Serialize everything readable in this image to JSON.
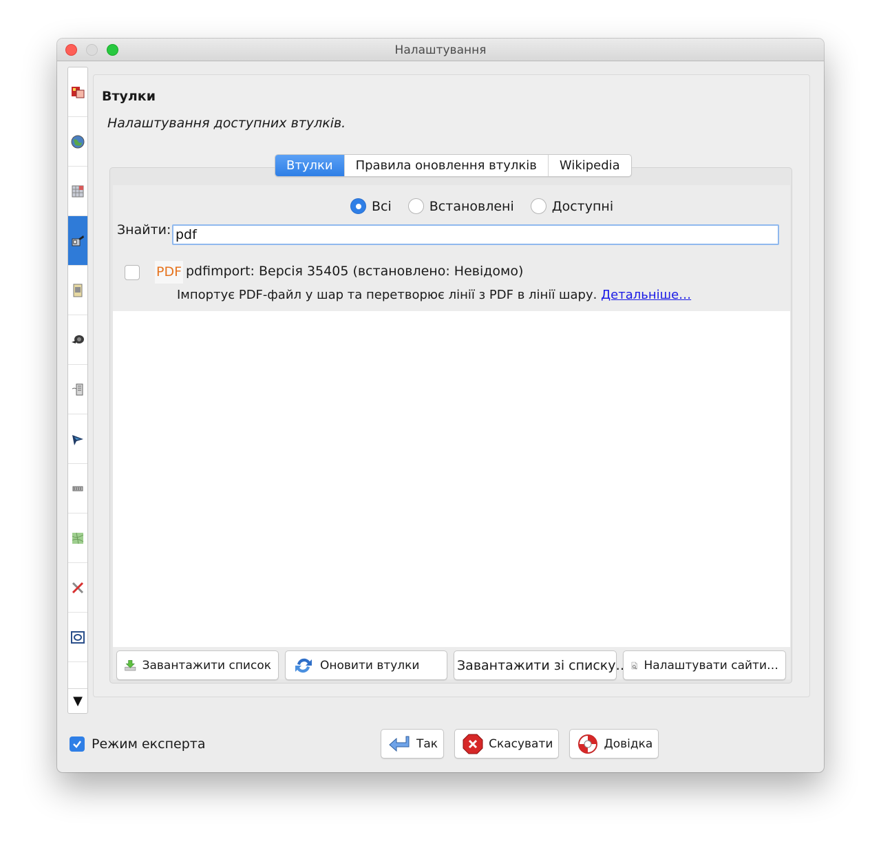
{
  "window": {
    "title": "Налаштування"
  },
  "sidebar": {
    "items": [
      {
        "icon": "display-settings-icon"
      },
      {
        "icon": "globe-icon"
      },
      {
        "icon": "map-projection-icon"
      },
      {
        "icon": "plugin-icon",
        "active": true
      },
      {
        "icon": "presets-icon"
      },
      {
        "icon": "remote-control-icon"
      },
      {
        "icon": "connection-icon"
      },
      {
        "icon": "shortcuts-icon"
      },
      {
        "icon": "validator-icon"
      },
      {
        "icon": "imagery-icon"
      },
      {
        "icon": "tools-icon"
      },
      {
        "icon": "frame-icon"
      }
    ],
    "scroll_down_icon": "▼"
  },
  "panel": {
    "heading": "Втулки",
    "subheading": "Налаштування доступних втулків."
  },
  "tabs": [
    {
      "label": "Втулки",
      "active": true
    },
    {
      "label": "Правила оновлення втулків",
      "active": false
    },
    {
      "label": "Wikipedia",
      "active": false
    }
  ],
  "filter": {
    "options": [
      {
        "label": "Всі",
        "checked": true
      },
      {
        "label": "Встановлені",
        "checked": false
      },
      {
        "label": "Доступні",
        "checked": false
      }
    ]
  },
  "search": {
    "label": "Знайти:",
    "value": "pdf"
  },
  "plugins": [
    {
      "badge": "PDF",
      "title": "pdfimport: Версія 35405 (встановлено: Невідомо)",
      "description": "Імпортує PDF-файл у шар та перетворює лінії з PDF в лінії шару.",
      "link": "Детальніше…",
      "checked": false
    }
  ],
  "buttons": {
    "download_list": "Завантажити список",
    "update_plugins": "Оновити втулки",
    "load_from_list": "Завантажити зі списку…",
    "configure_sites": "Налаштувати сайти…"
  },
  "footer": {
    "expert_mode": {
      "label": "Режим експерта",
      "checked": true
    },
    "ok": "Так",
    "cancel": "Скасувати",
    "help": "Довідка"
  },
  "colors": {
    "accent": "#2f7fe6",
    "pdf_badge": "#e6731e",
    "link": "#1a1ae6",
    "close": "#fe5f57",
    "maximize": "#28c840"
  }
}
